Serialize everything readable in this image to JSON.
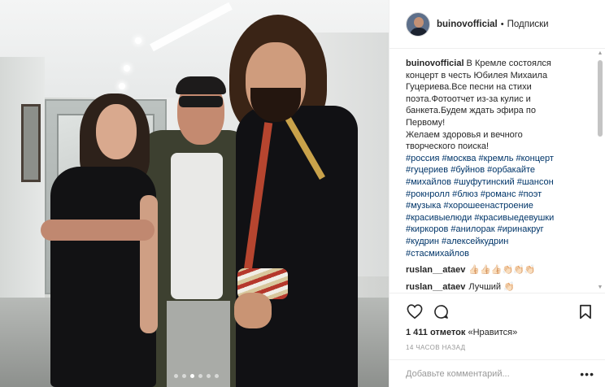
{
  "post": {
    "image_alt": "",
    "carousel_total": 6,
    "carousel_active": 3
  },
  "header": {
    "username": "buinovofficial",
    "separator": "•",
    "follow_label": "Подписки"
  },
  "caption": {
    "username": "buinovofficial",
    "text_lines": [
      " В Кремле состоялся",
      "концерт в честь Юбилея Михаила",
      "Гуцериева.Все песни на стихи",
      "поэта.Фотоотчет из-за кулис и",
      "банкета.Будем ждать эфира по",
      "Первому!",
      "Желаем здоровья и вечного",
      "творческого поиска!"
    ]
  },
  "hashtags": [
    "#россия",
    "#москва",
    "#кремль",
    "#концерт",
    "#гуцериев",
    "#буйнов",
    "#орбакайте",
    "#михайлов",
    "#шуфутинский",
    "#шансон",
    "#рокнролл",
    "#блюз",
    "#романс",
    "#поэт",
    "#музыка",
    "#хорошеенастроение",
    "#красивыелюди",
    "#красивыедевушки",
    "#киркоров",
    "#анилорак",
    "#иринакруг",
    "#кудрин",
    "#алексейкудрин",
    "#стасмихайлов"
  ],
  "comments": [
    {
      "user": "ruslan__ataev",
      "text": "👍🏻👍🏻👍🏻👏🏻👏🏻👏🏻"
    },
    {
      "user": "ruslan__ataev",
      "text": "Лучший 👏🏻"
    }
  ],
  "actions": {
    "like_icon": "heart-icon",
    "comment_icon": "comment-bubble-icon",
    "save_icon": "bookmark-icon"
  },
  "likes": {
    "count": "1 411 отметок",
    "label": " «Нравится»"
  },
  "time_ago": "14 часов назад",
  "add_comment": {
    "placeholder": "Добавьте комментарий...",
    "more_icon": "more-options-icon"
  },
  "colors": {
    "text": "#262626",
    "hashtag": "#003569",
    "muted": "#999999",
    "border": "#efefef"
  }
}
